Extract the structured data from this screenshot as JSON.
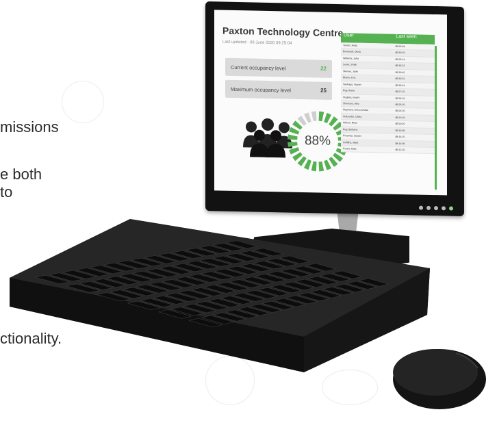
{
  "background_text": {
    "line1": "missions",
    "line2": "e both",
    "line3": "to",
    "line4": "ctionality."
  },
  "screen": {
    "title": "Paxton Technology Centre",
    "last_updated": "Last updated - 09 June 2020 09:25:04",
    "current_label": "Current occupancy level",
    "current_value": "22",
    "max_label": "Maximum occupancy level",
    "max_value": "25",
    "occupancy_percent": "88%",
    "occupancy_fraction": 0.88,
    "table": {
      "headers": [
        "User",
        "Last seen"
      ],
      "rows": [
        [
          "Tanner, Andy",
          "08:56:09"
        ],
        [
          "Bowlandt, Olivia",
          "08:30:15"
        ],
        [
          "Williams, John",
          "08:26:14"
        ],
        [
          "Lewis, Smith",
          "08:35:23"
        ],
        [
          "Skinner, Jade",
          "08:30:45"
        ],
        [
          "Blamo, Eric",
          "08:30:22"
        ],
        [
          "Santiago, Hayan",
          "08:30:24"
        ],
        [
          "Ray, Annie",
          "08:27:15"
        ],
        [
          "Hughes, Imami",
          "08:26:10"
        ],
        [
          "Simmons, Alex",
          "08:25:15"
        ],
        [
          "Stephens, Eleccia-Mae",
          "08:24:25"
        ],
        [
          "Holcombe, Olivia",
          "08:23:25"
        ],
        [
          "Wilson, Rhys",
          "08:20:25"
        ],
        [
          "Ray, Bethany",
          "08:15:05"
        ],
        [
          "Freeman, Daniel",
          "08:14:15"
        ],
        [
          "Griffiths, Mark",
          "08:14:05"
        ],
        [
          "Foster, Mike",
          "08:12:25"
        ]
      ]
    }
  },
  "colors": {
    "accent": "#56b153",
    "donut_remaining": "#cfcfcf",
    "bezel": "#121212"
  }
}
